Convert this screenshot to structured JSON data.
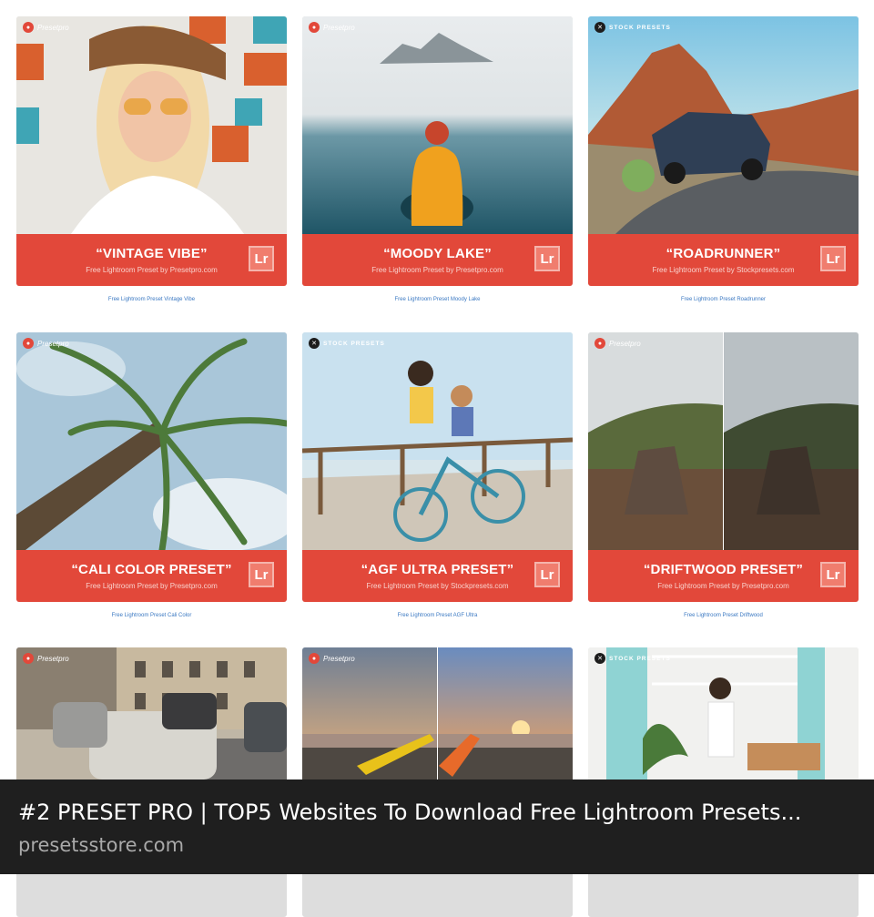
{
  "cards": [
    {
      "title": "“VINTAGE VIBE”",
      "subtitle": "Free Lightroom Preset by Presetpro.com",
      "caption": "Free Lightroom Preset Vintage Vibe",
      "brand": "Presetpro",
      "badge": "Lr"
    },
    {
      "title": "“MOODY LAKE”",
      "subtitle": "Free Lightroom Preset by Presetpro.com",
      "caption": "Free Lightroom Preset Moody Lake",
      "brand": "Presetpro",
      "badge": "Lr"
    },
    {
      "title": "“ROADRUNNER”",
      "subtitle": "Free Lightroom Preset by Stockpresets.com",
      "caption": "Free Lightroom Preset Roadrunner",
      "brand": "STOCK PRESETS",
      "badge": "Lr"
    },
    {
      "title": "“CALI COLOR PRESET”",
      "subtitle": "Free Lightroom Preset by Presetpro.com",
      "caption": "Free Lightroom Preset Cali Color",
      "brand": "Presetpro",
      "badge": "Lr"
    },
    {
      "title": "“AGF ULTRA PRESET”",
      "subtitle": "Free Lightroom Preset by Stockpresets.com",
      "caption": "Free Lightroom Preset AGF Ultra",
      "brand": "STOCK PRESETS",
      "badge": "Lr"
    },
    {
      "title": "“DRIFTWOOD PRESET”",
      "subtitle": "Free Lightroom Preset by Presetpro.com",
      "caption": "Free Lightroom Preset Driftwood",
      "brand": "Presetpro",
      "badge": "Lr"
    },
    {
      "brand": "Presetpro"
    },
    {
      "brand": "Presetpro"
    },
    {
      "brand": "STOCK PRESETS"
    }
  ],
  "footer": {
    "title": "#2 PRESET PRO | TOP5 Websites To Download Free Lightroom Presets...",
    "site": "presetsstore.com"
  },
  "colors": {
    "band": "#e2483a",
    "caption_link": "#3a78c2",
    "footer_bg": "#1f1f1f"
  }
}
